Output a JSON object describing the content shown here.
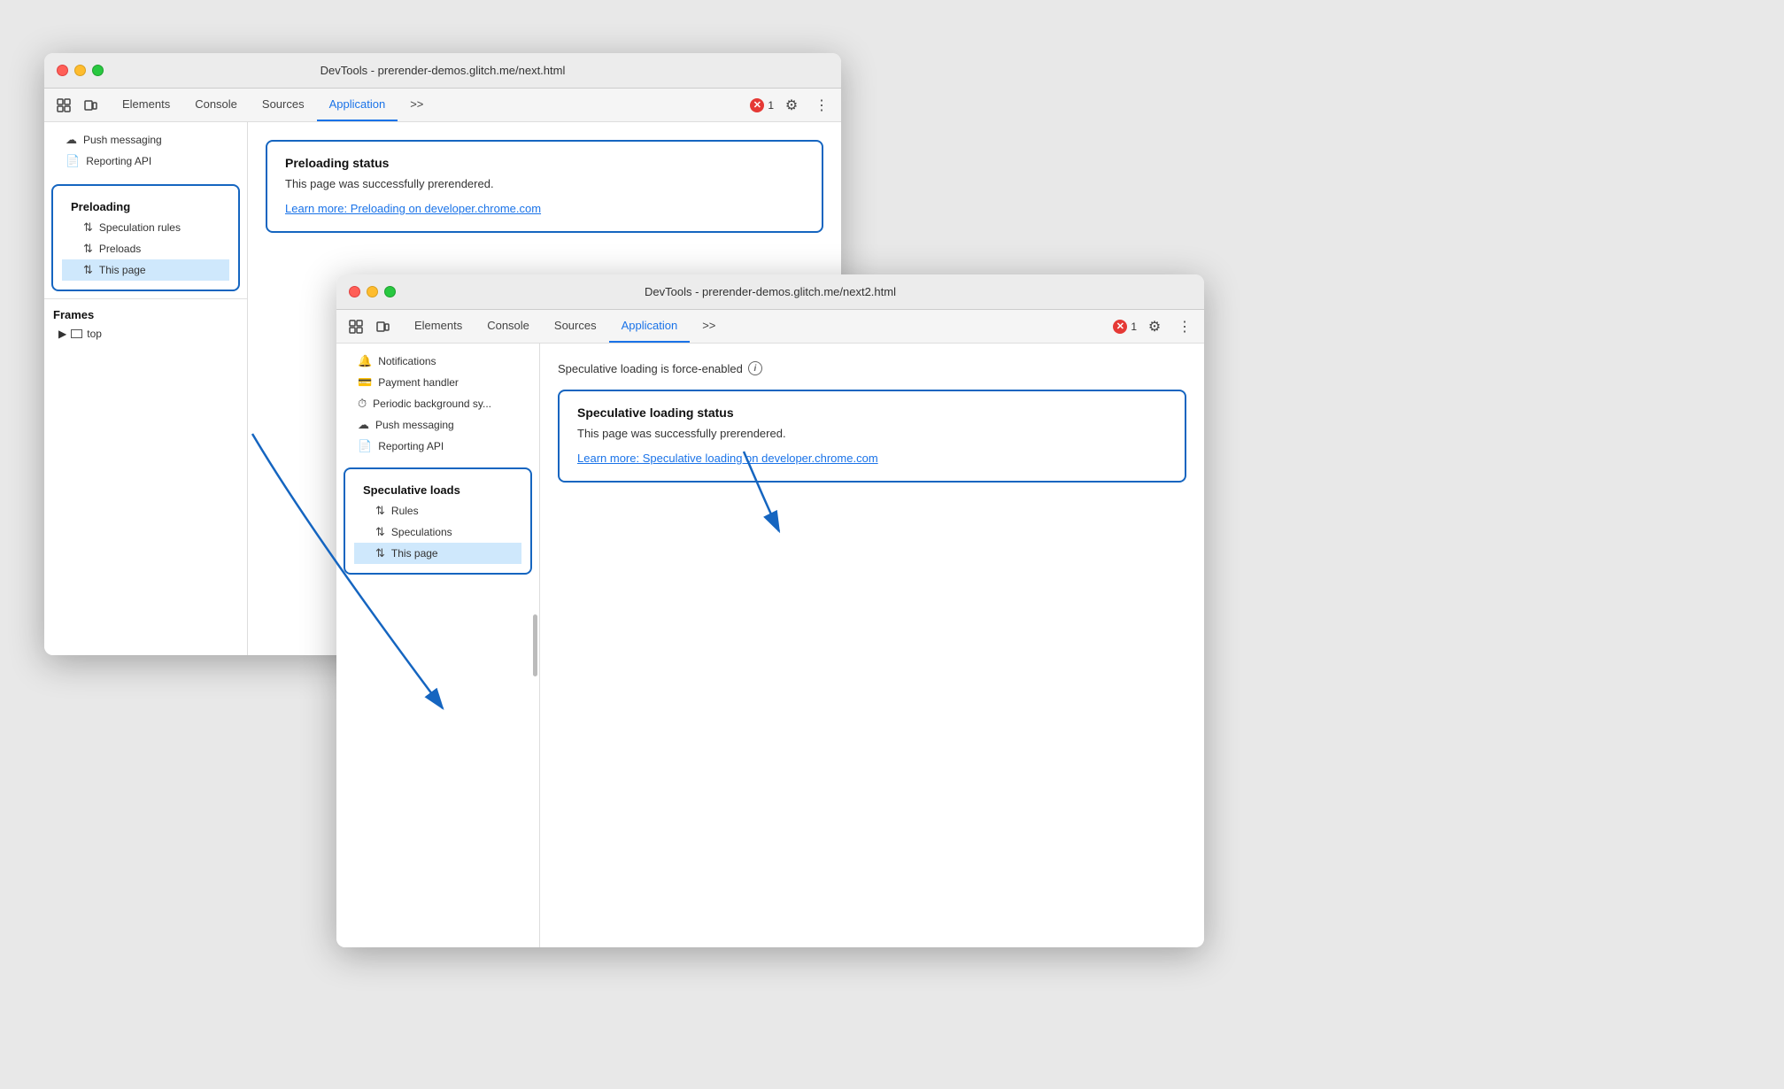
{
  "window1": {
    "title": "DevTools - prerender-demos.glitch.me/next.html",
    "tabs": [
      {
        "label": "Elements"
      },
      {
        "label": "Console"
      },
      {
        "label": "Sources"
      },
      {
        "label": "Application",
        "active": true
      }
    ],
    "toolbar": {
      "more_label": ">>",
      "error_count": "1",
      "settings_label": "⚙",
      "more_options": "⋮"
    },
    "sidebar": {
      "top_items": [
        {
          "icon": "☁",
          "label": "Push messaging"
        },
        {
          "icon": "📄",
          "label": "Reporting API"
        }
      ],
      "preloading_group": "Preloading",
      "preloading_items": [
        {
          "icon": "⇅",
          "label": "Speculation rules"
        },
        {
          "icon": "⇅",
          "label": "Preloads"
        },
        {
          "icon": "⇅",
          "label": "This page",
          "active": true
        }
      ],
      "frames_group": "Frames",
      "frames_items": [
        {
          "icon": "▶",
          "label": "top",
          "indent": true
        }
      ]
    },
    "main": {
      "status_box": {
        "title": "Preloading status",
        "text": "This page was successfully prerendered.",
        "link": "Learn more: Preloading on developer.chrome.com"
      }
    }
  },
  "window2": {
    "title": "DevTools - prerender-demos.glitch.me/next2.html",
    "tabs": [
      {
        "label": "Elements"
      },
      {
        "label": "Console"
      },
      {
        "label": "Sources"
      },
      {
        "label": "Application",
        "active": true
      }
    ],
    "toolbar": {
      "more_label": ">>",
      "error_count": "1",
      "settings_label": "⚙",
      "more_options": "⋮"
    },
    "sidebar": {
      "items": [
        {
          "icon": "🔔",
          "label": "Notifications"
        },
        {
          "icon": "💳",
          "label": "Payment handler"
        },
        {
          "icon": "⏱",
          "label": "Periodic background sy..."
        },
        {
          "icon": "☁",
          "label": "Push messaging"
        },
        {
          "icon": "📄",
          "label": "Reporting API"
        }
      ],
      "speculative_group": "Speculative loads",
      "speculative_items": [
        {
          "icon": "⇅",
          "label": "Rules"
        },
        {
          "icon": "⇅",
          "label": "Speculations"
        },
        {
          "icon": "⇅",
          "label": "This page",
          "active": true
        }
      ]
    },
    "main": {
      "force_enabled": "Speculative loading is force-enabled",
      "status_box": {
        "title": "Speculative loading status",
        "text": "This page was successfully prerendered.",
        "link": "Learn more: Speculative loading on developer.chrome.com"
      }
    }
  }
}
